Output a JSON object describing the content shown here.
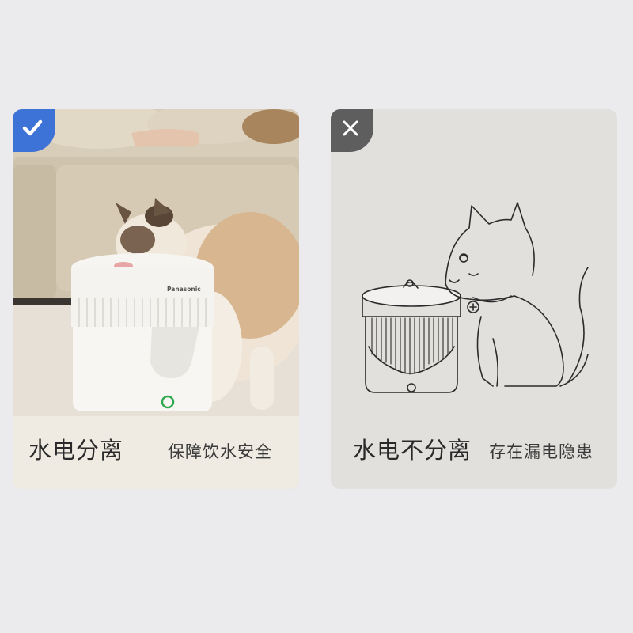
{
  "left_card": {
    "badge_icon": "check-icon",
    "badge_color": "#3d72d6",
    "product_brand": "Panasonic",
    "indicator_color": "#2fa84f",
    "title": "水电分离",
    "subtitle": "保障饮水安全"
  },
  "right_card": {
    "badge_icon": "cross-icon",
    "badge_color": "#5e5e5e",
    "title": "水电不分离",
    "subtitle": "存在漏电隐患"
  }
}
